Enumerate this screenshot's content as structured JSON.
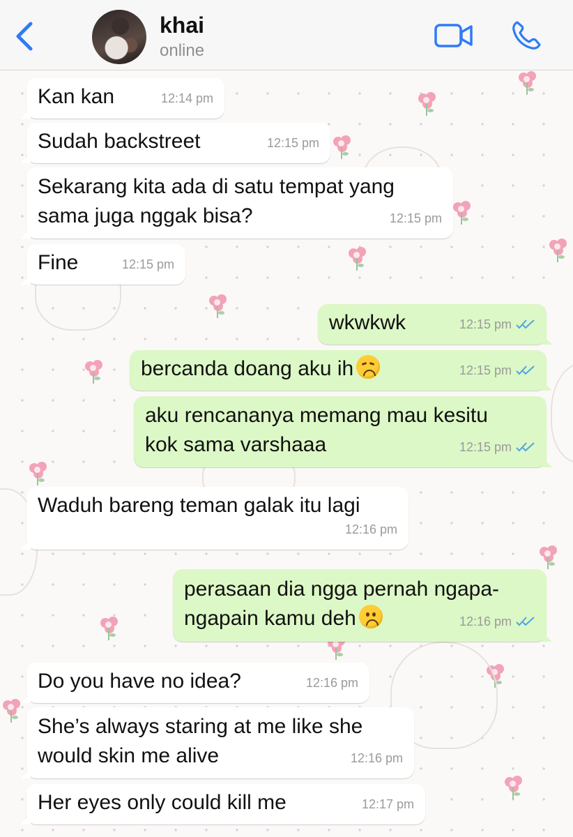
{
  "header": {
    "contact_name": "khai",
    "contact_status": "online",
    "back_icon": "chevron-left-icon",
    "video_icon": "video-camera-icon",
    "call_icon": "phone-icon",
    "accent_color": "#2f7bf6"
  },
  "messages": [
    {
      "direction": "incoming",
      "text": "Kan kan",
      "time": "12:14 pm"
    },
    {
      "direction": "incoming",
      "text": "Sudah backstreet",
      "time": "12:15 pm"
    },
    {
      "direction": "incoming",
      "text": "Sekarang kita ada di satu tempat yang\nsama juga nggak bisa?",
      "time": "12:15 pm"
    },
    {
      "direction": "incoming",
      "text": "Fine",
      "time": "12:15 pm"
    },
    {
      "direction": "outgoing",
      "text": "wkwkwk",
      "time": "12:15 pm",
      "status": "read"
    },
    {
      "direction": "outgoing",
      "text": "bercanda doang aku ih",
      "emoji": "disappointed-face",
      "time": "12:15 pm",
      "status": "read"
    },
    {
      "direction": "outgoing",
      "text": "aku rencananya memang mau kesitu\nkok sama varshaaa",
      "time": "12:15 pm",
      "status": "read"
    },
    {
      "direction": "incoming",
      "text": "Waduh bareng teman galak itu lagi",
      "time": "12:16 pm"
    },
    {
      "direction": "outgoing",
      "text": "perasaan dia ngga pernah ngapa-\nngapain kamu deh",
      "emoji": "slightly-frowning-face",
      "time": "12:16 pm",
      "status": "read"
    },
    {
      "direction": "incoming",
      "text": "Do you have no idea?",
      "time": "12:16 pm"
    },
    {
      "direction": "incoming",
      "text": "She’s always staring at me like she\nwould skin me alive",
      "time": "12:16 pm"
    },
    {
      "direction": "incoming",
      "text": "Her eyes only could kill me",
      "time": "12:17 pm"
    }
  ],
  "colors": {
    "incoming_bubble": "#ffffff",
    "outgoing_bubble": "#dcf8c6",
    "read_ticks": "#4fa3e8"
  }
}
